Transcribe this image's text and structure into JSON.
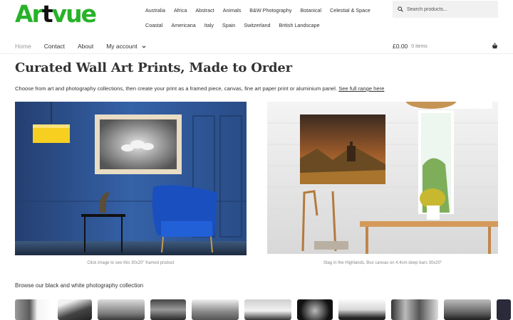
{
  "brand": {
    "logo_green1": "Ar",
    "logo_black": "t",
    "logo_green2": "vue"
  },
  "categories_row1": [
    "Australia",
    "Africa",
    "Abstract",
    "Animals",
    "B&W Photography",
    "Botanical",
    "Celestial & Space"
  ],
  "categories_row2": [
    "Coastal",
    "Americana",
    "Italy",
    "Spain",
    "Switzerland",
    "British Landscape"
  ],
  "search": {
    "placeholder": "Search products..."
  },
  "nav": {
    "home": "Home",
    "contact": "Contact",
    "about": "About",
    "account": "My account"
  },
  "cart": {
    "amount": "£0.00",
    "items": "0 items"
  },
  "page": {
    "title": "Curated Wall Art Prints, Made to Order",
    "intro": "Choose from art and photography collections, then create your print as a framed piece, canvas, fine art paper print or aluminium panel.",
    "intro_link": "See full range here",
    "caption_left": "Click image to see this 30x20\" framed product",
    "caption_right": "Stag in the Highlands, Box canvas on 4.4cm deep bars 30x20\"",
    "browse": "Browse our black and white photography collection"
  },
  "colors": {
    "brand_green": "#28b228",
    "wall_blue": "#2f5c9c"
  }
}
